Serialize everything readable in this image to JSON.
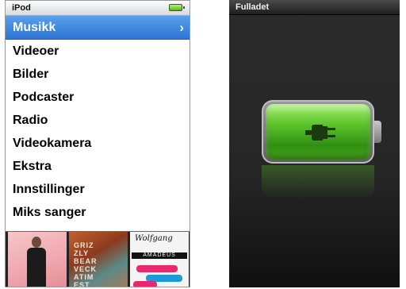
{
  "ipod": {
    "title": "iPod",
    "battery_icon": "battery-icon",
    "menu": [
      {
        "label": "Musikk",
        "selected": true
      },
      {
        "label": "Videoer",
        "selected": false
      },
      {
        "label": "Bilder",
        "selected": false
      },
      {
        "label": "Podcaster",
        "selected": false
      },
      {
        "label": "Radio",
        "selected": false
      },
      {
        "label": "Videokamera",
        "selected": false
      },
      {
        "label": "Ekstra",
        "selected": false
      },
      {
        "label": "Innstillinger",
        "selected": false
      },
      {
        "label": "Miks sanger",
        "selected": false
      }
    ],
    "chevron": "›",
    "albums": {
      "album2_text": "GRIZ\nZLY\nBEAR\nVECK\nATIM\nEST",
      "album3_script": "Wolfgang",
      "album3_band": "AMADEUS PHOENIX"
    }
  },
  "charging": {
    "title": "Fulladet",
    "icon": "battery-plug-icon"
  },
  "colors": {
    "selected_bg": "#3d86e0",
    "battery_green": "#5fc72c",
    "charge_bg": "#262626"
  }
}
